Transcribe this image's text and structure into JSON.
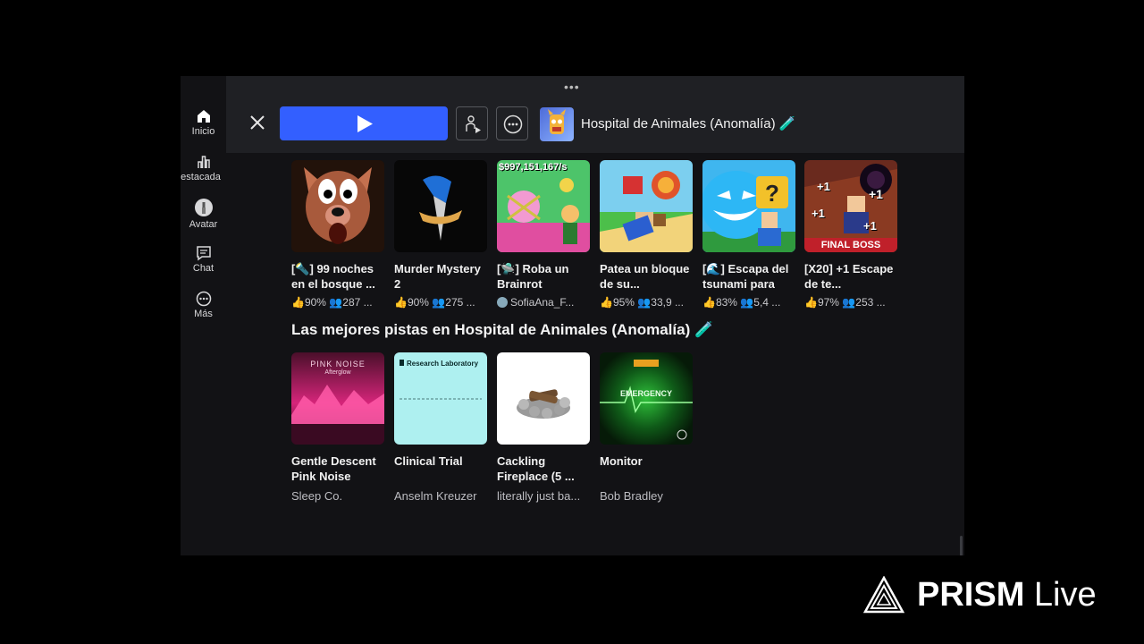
{
  "sidebar": {
    "items": [
      {
        "label": "Inicio",
        "icon": "home-icon"
      },
      {
        "label": "estacada",
        "icon": "charts-icon"
      },
      {
        "label": "Avatar",
        "icon": "avatar-icon"
      },
      {
        "label": "Chat",
        "icon": "chat-icon"
      },
      {
        "label": "Más",
        "icon": "more-icon"
      }
    ]
  },
  "topbar": {
    "drag_handle": "•••",
    "game_title": "Hospital de Animales (Anomalía) 🧪"
  },
  "games": [
    {
      "name": "[🔦] 99 noches en el bosque ...",
      "rating": "90%",
      "players": "287 ..."
    },
    {
      "name": "Murder Mystery 2",
      "rating": "90%",
      "players": "275 ..."
    },
    {
      "name": "[🛸] Roba un Brainrot",
      "creator": "SofiaAna_F...",
      "overlay": "$997,151,167/s"
    },
    {
      "name": "Patea un bloque de su...",
      "rating": "95%",
      "players": "33,9 ..."
    },
    {
      "name": "[🌊] Escapa del tsunami para",
      "rating": "83%",
      "players": "5,4 ..."
    },
    {
      "name": "[X20] +1 Escape de te...",
      "rating": "97%",
      "players": "253 ...",
      "overlay": "FINAL BOSS",
      "plus": "+1"
    }
  ],
  "tracks_section": {
    "title": "Las mejores pistas en Hospital de Animales (Anomalía) 🧪",
    "tracks": [
      {
        "name": "Gentle Descent Pink Noise",
        "artist": "Sleep Co.",
        "cover_text": "PINK NOISE",
        "cover_sub": "Afterglow"
      },
      {
        "name": "Clinical Trial",
        "artist": "Anselm Kreuzer",
        "cover_text": "Research Laboratory"
      },
      {
        "name": "Cackling Fireplace (5 ...",
        "artist": "literally just ba..."
      },
      {
        "name": "Monitor",
        "artist": "Bob Bradley",
        "cover_text": "EMERGENCY"
      }
    ]
  },
  "watermark": {
    "bold": "PRISM",
    "light": "Live"
  },
  "colors": {
    "play_button": "#335fff",
    "background": "#121215",
    "topbar": "#1f2024"
  }
}
